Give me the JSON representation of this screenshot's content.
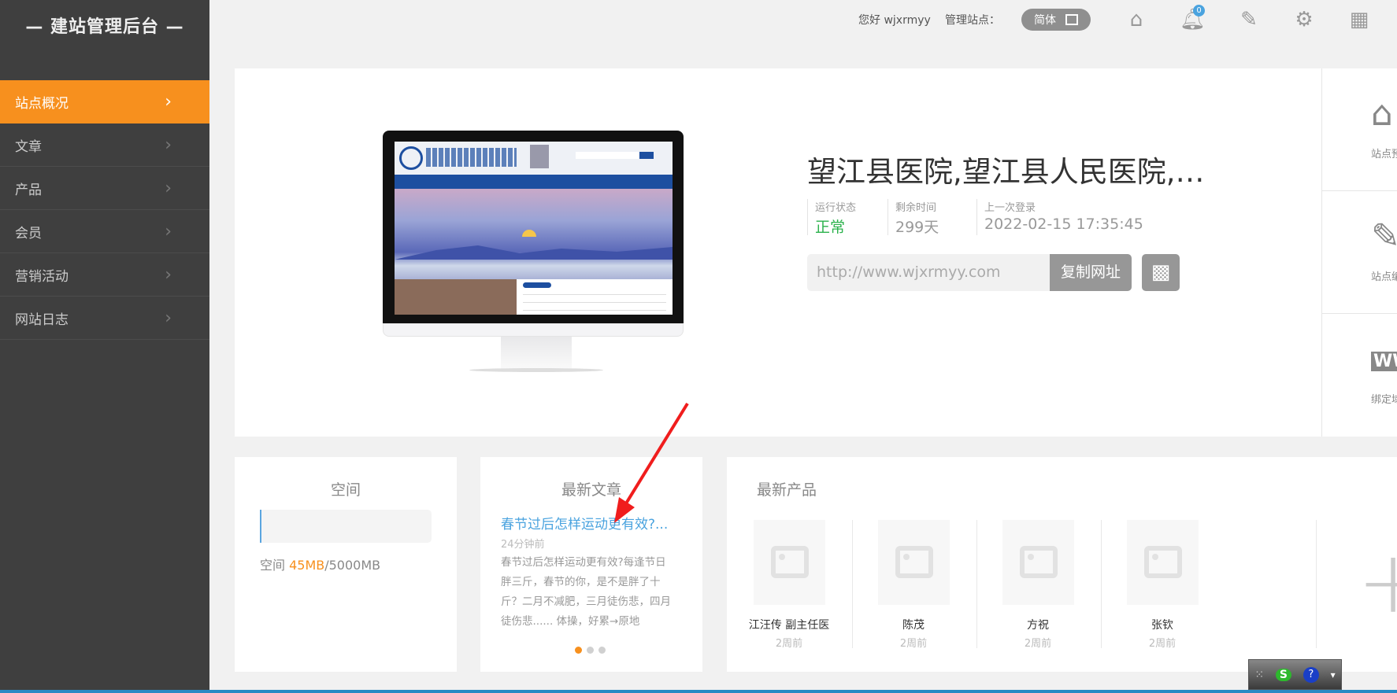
{
  "sidebar": {
    "title": "— 建站管理后台 —",
    "items": [
      {
        "label": "站点概况",
        "active": true
      },
      {
        "label": "文章"
      },
      {
        "label": "产品"
      },
      {
        "label": "会员"
      },
      {
        "label": "营销活动"
      },
      {
        "label": "网站日志"
      }
    ]
  },
  "header": {
    "greeting": "您好 wjxrmyy",
    "manage_label": "管理站点：",
    "lang_label": "简体",
    "notification_count": "0",
    "icons": [
      "home-icon",
      "bell-icon",
      "edit-icon",
      "gear-icon",
      "grid-icon"
    ]
  },
  "site": {
    "title": "望江县医院,望江县人民医院,…",
    "stats": [
      {
        "label": "运行状态",
        "value": "正常",
        "color": "#2bb24c"
      },
      {
        "label": "剩余时间",
        "value": "299天"
      },
      {
        "label": "上一次登录",
        "value": "2022-02-15 17:35:45"
      }
    ],
    "url": "http://www.wjxrmyy.com",
    "copy_label": "复制网址"
  },
  "right_panel": [
    {
      "label": "站点预览",
      "icon": "home-icon"
    },
    {
      "label": "站点编辑",
      "icon": "pen-icon"
    },
    {
      "label": "绑定域名",
      "icon": "www-icon"
    }
  ],
  "space": {
    "title": "空间",
    "label": "空间 ",
    "used": "45MB",
    "total": "/5000MB",
    "usage_fraction": 0.009
  },
  "articles": {
    "title": "最新文章",
    "link": "春节过后怎样运动更有效?...",
    "time": "24分钟前",
    "body": "春节过后怎样运动更有效?每逢节日胖三斤，春节的你，是不是胖了十斤？二月不减肥，三月徒伤悲，四月徒伤悲...... 体操，好累→原地",
    "active_page": 1,
    "pages": 3
  },
  "products": {
    "title": "最新产品",
    "items": [
      {
        "name": "江汪传 副主任医",
        "time": "2周前"
      },
      {
        "name": "陈茂",
        "time": "2周前"
      },
      {
        "name": "方祝",
        "time": "2周前"
      },
      {
        "name": "张钦",
        "time": "2周前"
      }
    ]
  },
  "colors": {
    "accent": "#f7901e",
    "link": "#4aa3df",
    "sidebar": "#3f3f3f"
  }
}
